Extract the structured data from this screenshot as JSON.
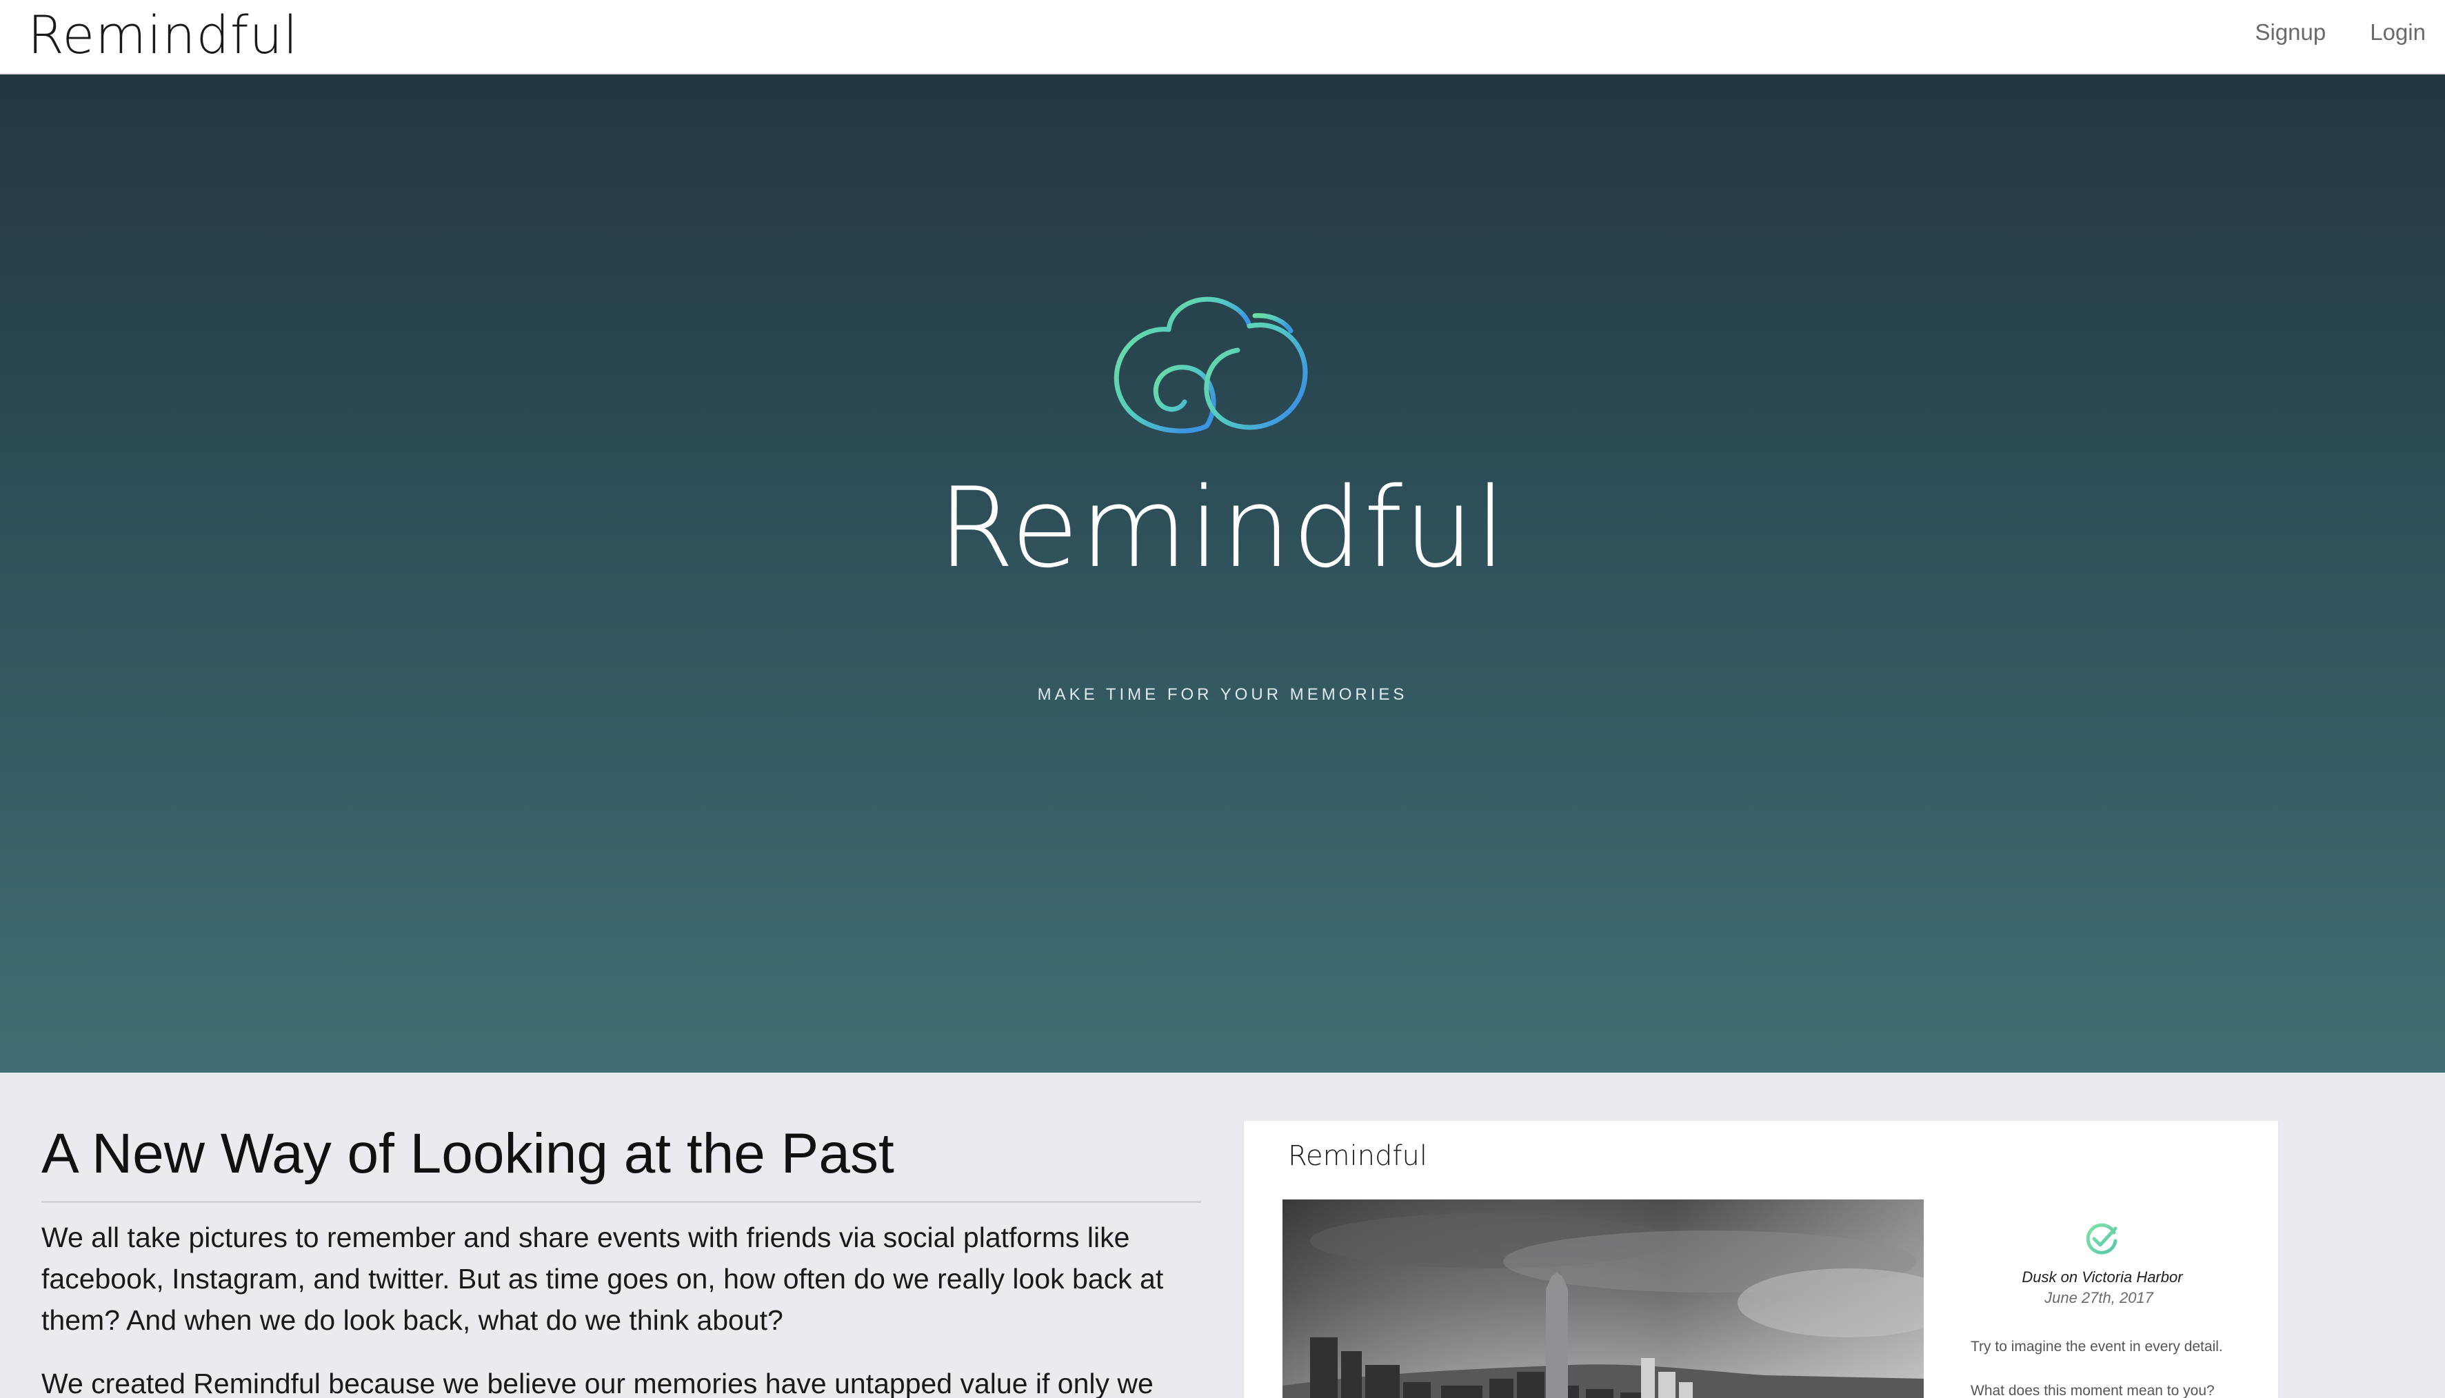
{
  "navbar": {
    "brand": "Remindful",
    "links": [
      {
        "label": "Signup"
      },
      {
        "label": "Login"
      }
    ]
  },
  "hero": {
    "title": "Remindful",
    "tagline": "MAKE TIME FOR YOUR MEMORIES",
    "logo_icon": "cloud-swirl-logo"
  },
  "intro": {
    "heading": "A New Way of Looking at the Past",
    "paragraphs": [
      "We all take pictures to remember and share events with friends via social platforms like facebook, Instagram, and twitter. But as time goes on, how often do we really look back at them? And when we do look back, what do we think about?",
      "We created Remindful because we believe our memories have untapped value if only we took"
    ]
  },
  "preview": {
    "brand": "Remindful",
    "memory": {
      "title": "Dusk on Victoria Harbor",
      "date": "June 27th, 2017",
      "prompts": [
        "Try to imagine the event in every detail.",
        "What does this moment mean to you?"
      ]
    },
    "check_icon": "check-circle-icon"
  },
  "colors": {
    "hero_top": "#223640",
    "hero_bottom": "#416e74",
    "accent_green": "#6fd8a0",
    "accent_blue": "#3f9fe0",
    "content_bg": "#eaebee"
  }
}
